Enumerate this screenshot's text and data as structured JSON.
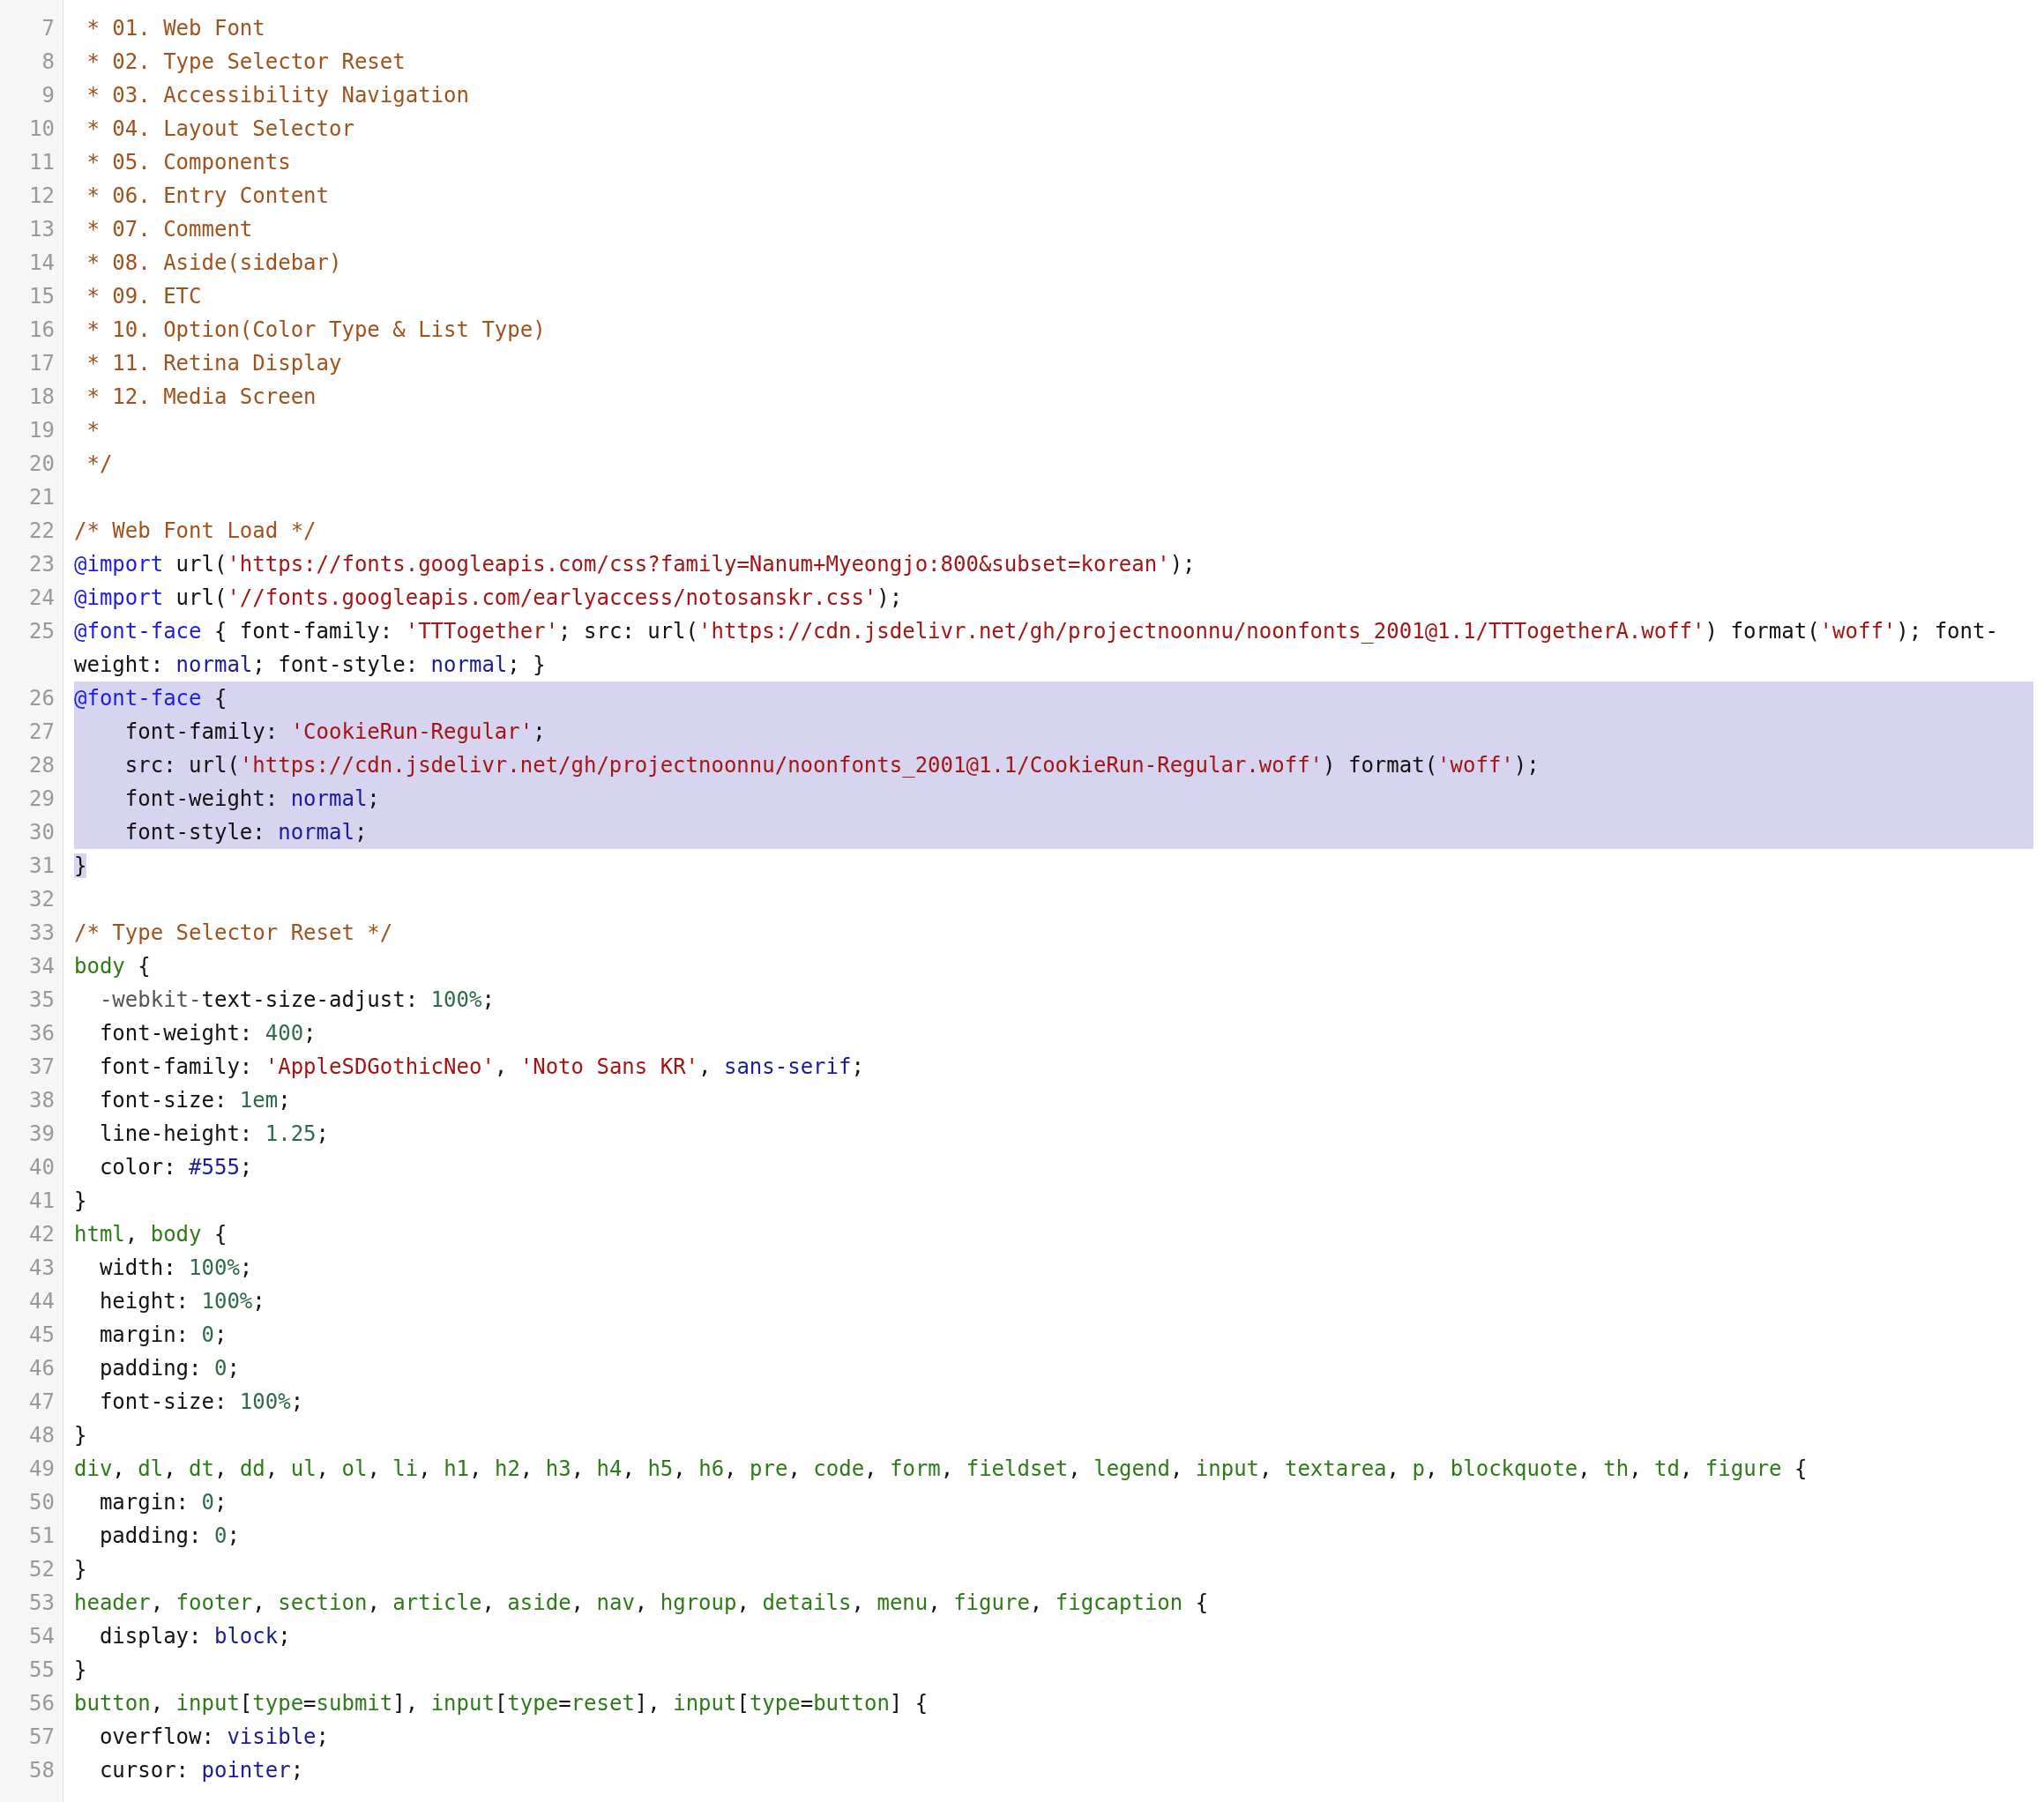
{
  "editor": {
    "lines": [
      {
        "number": "7",
        "selected": false,
        "tokens": [
          {
            "kind": "comment",
            "text": " * 01. Web Font"
          }
        ]
      },
      {
        "number": "8",
        "selected": false,
        "tokens": [
          {
            "kind": "comment",
            "text": " * 02. Type Selector Reset"
          }
        ]
      },
      {
        "number": "9",
        "selected": false,
        "tokens": [
          {
            "kind": "comment",
            "text": " * 03. Accessibility Navigation"
          }
        ]
      },
      {
        "number": "10",
        "selected": false,
        "tokens": [
          {
            "kind": "comment",
            "text": " * 04. Layout Selector"
          }
        ]
      },
      {
        "number": "11",
        "selected": false,
        "tokens": [
          {
            "kind": "comment",
            "text": " * 05. Components"
          }
        ]
      },
      {
        "number": "12",
        "selected": false,
        "tokens": [
          {
            "kind": "comment",
            "text": " * 06. Entry Content"
          }
        ]
      },
      {
        "number": "13",
        "selected": false,
        "tokens": [
          {
            "kind": "comment",
            "text": " * 07. Comment"
          }
        ]
      },
      {
        "number": "14",
        "selected": false,
        "tokens": [
          {
            "kind": "comment",
            "text": " * 08. Aside(sidebar)"
          }
        ]
      },
      {
        "number": "15",
        "selected": false,
        "tokens": [
          {
            "kind": "comment",
            "text": " * 09. ETC"
          }
        ]
      },
      {
        "number": "16",
        "selected": false,
        "tokens": [
          {
            "kind": "comment",
            "text": " * 10. Option(Color Type & List Type)"
          }
        ]
      },
      {
        "number": "17",
        "selected": false,
        "tokens": [
          {
            "kind": "comment",
            "text": " * 11. Retina Display"
          }
        ]
      },
      {
        "number": "18",
        "selected": false,
        "tokens": [
          {
            "kind": "comment",
            "text": " * 12. Media Screen"
          }
        ]
      },
      {
        "number": "19",
        "selected": false,
        "tokens": [
          {
            "kind": "comment",
            "text": " *"
          }
        ]
      },
      {
        "number": "20",
        "selected": false,
        "tokens": [
          {
            "kind": "comment",
            "text": " */"
          }
        ]
      },
      {
        "number": "21",
        "selected": false
      },
      {
        "number": "22",
        "selected": false,
        "tokens": [
          {
            "kind": "comment",
            "text": "/* Web Font Load */"
          }
        ]
      },
      {
        "number": "23",
        "selected": false,
        "tokens": [
          {
            "kind": "atrule",
            "text": "@import"
          },
          {
            "kind": "plain",
            "text": " url("
          },
          {
            "kind": "string",
            "text": "'https://fonts.googleapis.com/css?family=Nanum+Myeongjo:800&subset=korean'"
          },
          {
            "kind": "plain",
            "text": ");"
          }
        ]
      },
      {
        "number": "24",
        "selected": false,
        "tokens": [
          {
            "kind": "atrule",
            "text": "@import"
          },
          {
            "kind": "plain",
            "text": " url("
          },
          {
            "kind": "string",
            "text": "'//fonts.googleapis.com/earlyaccess/notosanskr.css'"
          },
          {
            "kind": "plain",
            "text": ");"
          }
        ]
      },
      {
        "number": "25",
        "selected": false,
        "tokens": [
          {
            "kind": "atrule",
            "text": "@font-face"
          },
          {
            "kind": "plain",
            "text": " { font-family: "
          },
          {
            "kind": "string",
            "text": "'TTTogether'"
          },
          {
            "kind": "plain",
            "text": "; src: url("
          },
          {
            "kind": "string",
            "text": "'https://cdn.jsdelivr.net/gh/projectnoonnu/noonfonts_2001@1.1/TTTogetherA.woff'"
          },
          {
            "kind": "plain",
            "text": ") format("
          },
          {
            "kind": "string",
            "text": "'woff'"
          },
          {
            "kind": "plain",
            "text": "); font-weight: "
          },
          {
            "kind": "keyword",
            "text": "normal"
          },
          {
            "kind": "plain",
            "text": "; font-style: "
          },
          {
            "kind": "keyword",
            "text": "normal"
          },
          {
            "kind": "plain",
            "text": "; }"
          }
        ]
      },
      {
        "number": "26",
        "selected": true,
        "tokens": [
          {
            "kind": "atrule",
            "text": "@font-face"
          },
          {
            "kind": "plain",
            "text": " {"
          }
        ]
      },
      {
        "number": "27",
        "selected": true,
        "tokens": [
          {
            "kind": "plain",
            "text": "    font-family: "
          },
          {
            "kind": "string",
            "text": "'CookieRun-Regular'"
          },
          {
            "kind": "plain",
            "text": ";"
          }
        ]
      },
      {
        "number": "28",
        "selected": true,
        "tokens": [
          {
            "kind": "plain",
            "text": "    src: url("
          },
          {
            "kind": "string",
            "text": "'https://cdn.jsdelivr.net/gh/projectnoonnu/noonfonts_2001@1.1/CookieRun-Regular.woff'"
          },
          {
            "kind": "plain",
            "text": ") format("
          },
          {
            "kind": "string",
            "text": "'woff'"
          },
          {
            "kind": "plain",
            "text": ");"
          }
        ]
      },
      {
        "number": "29",
        "selected": true,
        "tokens": [
          {
            "kind": "plain",
            "text": "    font-weight: "
          },
          {
            "kind": "keyword",
            "text": "normal"
          },
          {
            "kind": "plain",
            "text": ";"
          }
        ]
      },
      {
        "number": "30",
        "selected": true,
        "tokens": [
          {
            "kind": "plain",
            "text": "    font-style: "
          },
          {
            "kind": "keyword",
            "text": "normal"
          },
          {
            "kind": "plain",
            "text": ";"
          }
        ]
      },
      {
        "number": "31",
        "selected": true,
        "tokens": [
          {
            "kind": "plain",
            "text": "}"
          }
        ]
      },
      {
        "number": "32",
        "selected": false
      },
      {
        "number": "33",
        "selected": false,
        "tokens": [
          {
            "kind": "comment",
            "text": "/* Type Selector Reset */"
          }
        ]
      },
      {
        "number": "34",
        "selected": false,
        "tokens": [
          {
            "kind": "selector",
            "text": "body"
          },
          {
            "kind": "plain",
            "text": " {"
          }
        ]
      },
      {
        "number": "35",
        "selected": false,
        "tokens": [
          {
            "kind": "vendor",
            "text": "  -webkit-"
          },
          {
            "kind": "plain",
            "text": "text-size-adjust: "
          },
          {
            "kind": "number",
            "text": "100%"
          },
          {
            "kind": "plain",
            "text": ";"
          }
        ]
      },
      {
        "number": "36",
        "selected": false,
        "tokens": [
          {
            "kind": "plain",
            "text": "  font-weight: "
          },
          {
            "kind": "number",
            "text": "400"
          },
          {
            "kind": "plain",
            "text": ";"
          }
        ]
      },
      {
        "number": "37",
        "selected": false,
        "tokens": [
          {
            "kind": "plain",
            "text": "  font-family: "
          },
          {
            "kind": "string",
            "text": "'AppleSDGothicNeo'"
          },
          {
            "kind": "plain",
            "text": ", "
          },
          {
            "kind": "string",
            "text": "'Noto Sans KR'"
          },
          {
            "kind": "plain",
            "text": ", "
          },
          {
            "kind": "keyword",
            "text": "sans-serif"
          },
          {
            "kind": "plain",
            "text": ";"
          }
        ]
      },
      {
        "number": "38",
        "selected": false,
        "tokens": [
          {
            "kind": "plain",
            "text": "  font-size: "
          },
          {
            "kind": "number",
            "text": "1em"
          },
          {
            "kind": "plain",
            "text": ";"
          }
        ]
      },
      {
        "number": "39",
        "selected": false,
        "tokens": [
          {
            "kind": "plain",
            "text": "  line-height: "
          },
          {
            "kind": "number",
            "text": "1.25"
          },
          {
            "kind": "plain",
            "text": ";"
          }
        ]
      },
      {
        "number": "40",
        "selected": false,
        "tokens": [
          {
            "kind": "plain",
            "text": "  color: "
          },
          {
            "kind": "keyword",
            "text": "#555"
          },
          {
            "kind": "plain",
            "text": ";"
          }
        ]
      },
      {
        "number": "41",
        "selected": false,
        "tokens": [
          {
            "kind": "plain",
            "text": "}"
          }
        ]
      },
      {
        "number": "42",
        "selected": false,
        "tokens": [
          {
            "kind": "selector",
            "text": "html"
          },
          {
            "kind": "plain",
            "text": ", "
          },
          {
            "kind": "selector",
            "text": "body"
          },
          {
            "kind": "plain",
            "text": " {"
          }
        ]
      },
      {
        "number": "43",
        "selected": false,
        "tokens": [
          {
            "kind": "plain",
            "text": "  width: "
          },
          {
            "kind": "number",
            "text": "100%"
          },
          {
            "kind": "plain",
            "text": ";"
          }
        ]
      },
      {
        "number": "44",
        "selected": false,
        "tokens": [
          {
            "kind": "plain",
            "text": "  height: "
          },
          {
            "kind": "number",
            "text": "100%"
          },
          {
            "kind": "plain",
            "text": ";"
          }
        ]
      },
      {
        "number": "45",
        "selected": false,
        "tokens": [
          {
            "kind": "plain",
            "text": "  margin: "
          },
          {
            "kind": "number",
            "text": "0"
          },
          {
            "kind": "plain",
            "text": ";"
          }
        ]
      },
      {
        "number": "46",
        "selected": false,
        "tokens": [
          {
            "kind": "plain",
            "text": "  padding: "
          },
          {
            "kind": "number",
            "text": "0"
          },
          {
            "kind": "plain",
            "text": ";"
          }
        ]
      },
      {
        "number": "47",
        "selected": false,
        "tokens": [
          {
            "kind": "plain",
            "text": "  font-size: "
          },
          {
            "kind": "number",
            "text": "100%"
          },
          {
            "kind": "plain",
            "text": ";"
          }
        ]
      },
      {
        "number": "48",
        "selected": false,
        "tokens": [
          {
            "kind": "plain",
            "text": "}"
          }
        ]
      },
      {
        "number": "49",
        "selected": false,
        "tokens": [
          {
            "kind": "selector",
            "text": "div"
          },
          {
            "kind": "plain",
            "text": ", "
          },
          {
            "kind": "selector",
            "text": "dl"
          },
          {
            "kind": "plain",
            "text": ", "
          },
          {
            "kind": "selector",
            "text": "dt"
          },
          {
            "kind": "plain",
            "text": ", "
          },
          {
            "kind": "selector",
            "text": "dd"
          },
          {
            "kind": "plain",
            "text": ", "
          },
          {
            "kind": "selector",
            "text": "ul"
          },
          {
            "kind": "plain",
            "text": ", "
          },
          {
            "kind": "selector",
            "text": "ol"
          },
          {
            "kind": "plain",
            "text": ", "
          },
          {
            "kind": "selector",
            "text": "li"
          },
          {
            "kind": "plain",
            "text": ", "
          },
          {
            "kind": "selector",
            "text": "h1"
          },
          {
            "kind": "plain",
            "text": ", "
          },
          {
            "kind": "selector",
            "text": "h2"
          },
          {
            "kind": "plain",
            "text": ", "
          },
          {
            "kind": "selector",
            "text": "h3"
          },
          {
            "kind": "plain",
            "text": ", "
          },
          {
            "kind": "selector",
            "text": "h4"
          },
          {
            "kind": "plain",
            "text": ", "
          },
          {
            "kind": "selector",
            "text": "h5"
          },
          {
            "kind": "plain",
            "text": ", "
          },
          {
            "kind": "selector",
            "text": "h6"
          },
          {
            "kind": "plain",
            "text": ", "
          },
          {
            "kind": "selector",
            "text": "pre"
          },
          {
            "kind": "plain",
            "text": ", "
          },
          {
            "kind": "selector",
            "text": "code"
          },
          {
            "kind": "plain",
            "text": ", "
          },
          {
            "kind": "selector",
            "text": "form"
          },
          {
            "kind": "plain",
            "text": ", "
          },
          {
            "kind": "selector",
            "text": "fieldset"
          },
          {
            "kind": "plain",
            "text": ", "
          },
          {
            "kind": "selector",
            "text": "legend"
          },
          {
            "kind": "plain",
            "text": ", "
          },
          {
            "kind": "selector",
            "text": "input"
          },
          {
            "kind": "plain",
            "text": ", "
          },
          {
            "kind": "selector",
            "text": "textarea"
          },
          {
            "kind": "plain",
            "text": ", "
          },
          {
            "kind": "selector",
            "text": "p"
          },
          {
            "kind": "plain",
            "text": ", "
          },
          {
            "kind": "selector",
            "text": "blockquote"
          },
          {
            "kind": "plain",
            "text": ", "
          },
          {
            "kind": "selector",
            "text": "th"
          },
          {
            "kind": "plain",
            "text": ", "
          },
          {
            "kind": "selector",
            "text": "td"
          },
          {
            "kind": "plain",
            "text": ", "
          },
          {
            "kind": "selector",
            "text": "figure"
          },
          {
            "kind": "plain",
            "text": " {"
          }
        ]
      },
      {
        "number": "50",
        "selected": false,
        "tokens": [
          {
            "kind": "plain",
            "text": "  margin: "
          },
          {
            "kind": "number",
            "text": "0"
          },
          {
            "kind": "plain",
            "text": ";"
          }
        ]
      },
      {
        "number": "51",
        "selected": false,
        "tokens": [
          {
            "kind": "plain",
            "text": "  padding: "
          },
          {
            "kind": "number",
            "text": "0"
          },
          {
            "kind": "plain",
            "text": ";"
          }
        ]
      },
      {
        "number": "52",
        "selected": false,
        "tokens": [
          {
            "kind": "plain",
            "text": "}"
          }
        ]
      },
      {
        "number": "53",
        "selected": false,
        "tokens": [
          {
            "kind": "selector",
            "text": "header"
          },
          {
            "kind": "plain",
            "text": ", "
          },
          {
            "kind": "selector",
            "text": "footer"
          },
          {
            "kind": "plain",
            "text": ", "
          },
          {
            "kind": "selector",
            "text": "section"
          },
          {
            "kind": "plain",
            "text": ", "
          },
          {
            "kind": "selector",
            "text": "article"
          },
          {
            "kind": "plain",
            "text": ", "
          },
          {
            "kind": "selector",
            "text": "aside"
          },
          {
            "kind": "plain",
            "text": ", "
          },
          {
            "kind": "selector",
            "text": "nav"
          },
          {
            "kind": "plain",
            "text": ", "
          },
          {
            "kind": "selector",
            "text": "hgroup"
          },
          {
            "kind": "plain",
            "text": ", "
          },
          {
            "kind": "selector",
            "text": "details"
          },
          {
            "kind": "plain",
            "text": ", "
          },
          {
            "kind": "selector",
            "text": "menu"
          },
          {
            "kind": "plain",
            "text": ", "
          },
          {
            "kind": "selector",
            "text": "figure"
          },
          {
            "kind": "plain",
            "text": ", "
          },
          {
            "kind": "selector",
            "text": "figcaption"
          },
          {
            "kind": "plain",
            "text": " {"
          }
        ]
      },
      {
        "number": "54",
        "selected": false,
        "tokens": [
          {
            "kind": "plain",
            "text": "  display: "
          },
          {
            "kind": "keyword",
            "text": "block"
          },
          {
            "kind": "plain",
            "text": ";"
          }
        ]
      },
      {
        "number": "55",
        "selected": false,
        "tokens": [
          {
            "kind": "plain",
            "text": "}"
          }
        ]
      },
      {
        "number": "56",
        "selected": false,
        "tokens": [
          {
            "kind": "selector",
            "text": "button"
          },
          {
            "kind": "plain",
            "text": ", "
          },
          {
            "kind": "selector",
            "text": "input"
          },
          {
            "kind": "plain",
            "text": "["
          },
          {
            "kind": "selector",
            "text": "type"
          },
          {
            "kind": "plain",
            "text": "="
          },
          {
            "kind": "selector",
            "text": "submit"
          },
          {
            "kind": "plain",
            "text": "], "
          },
          {
            "kind": "selector",
            "text": "input"
          },
          {
            "kind": "plain",
            "text": "["
          },
          {
            "kind": "selector",
            "text": "type"
          },
          {
            "kind": "plain",
            "text": "="
          },
          {
            "kind": "selector",
            "text": "reset"
          },
          {
            "kind": "plain",
            "text": "], "
          },
          {
            "kind": "selector",
            "text": "input"
          },
          {
            "kind": "plain",
            "text": "["
          },
          {
            "kind": "selector",
            "text": "type"
          },
          {
            "kind": "plain",
            "text": "="
          },
          {
            "kind": "selector",
            "text": "button"
          },
          {
            "kind": "plain",
            "text": "] {"
          }
        ]
      },
      {
        "number": "57",
        "selected": false,
        "tokens": [
          {
            "kind": "plain",
            "text": "  overflow: "
          },
          {
            "kind": "keyword",
            "text": "visible"
          },
          {
            "kind": "plain",
            "text": ";"
          }
        ]
      },
      {
        "number": "58",
        "selected": false,
        "tokens": [
          {
            "kind": "plain",
            "text": "  cursor: "
          },
          {
            "kind": "keyword",
            "text": "pointer"
          },
          {
            "kind": "plain",
            "text": ";"
          }
        ]
      }
    ]
  }
}
